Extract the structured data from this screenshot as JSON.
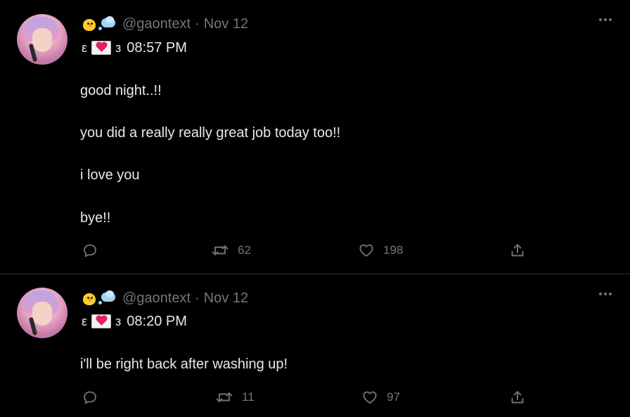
{
  "tweets": [
    {
      "handle": "@gaontext",
      "separator": "·",
      "date": "Nov 12",
      "sub_left": "ε",
      "sub_right": "з",
      "time": "08:57 PM",
      "body": [
        "good night..!!",
        "you did a really really great job today too!!",
        "i love you",
        "bye!!"
      ],
      "reply_count": "",
      "retweet_count": "62",
      "like_count": "198"
    },
    {
      "handle": "@gaontext",
      "separator": "·",
      "date": "Nov 12",
      "sub_left": "ε",
      "sub_right": "з",
      "time": "08:20 PM",
      "body": [
        "i'll be right back after washing up!"
      ],
      "reply_count": "",
      "retweet_count": "11",
      "like_count": "97"
    }
  ],
  "icons": {
    "name_emoji_1": "baby-chick-icon",
    "name_emoji_2": "thought-bubble-icon",
    "envelope": "love-letter-icon",
    "reply": "reply-icon",
    "retweet": "retweet-icon",
    "like": "heart-icon",
    "share": "share-icon",
    "more": "more-icon"
  },
  "colors": {
    "background": "#000000",
    "text": "#e7e9ea",
    "muted": "#71767b",
    "divider": "#2f3336"
  }
}
